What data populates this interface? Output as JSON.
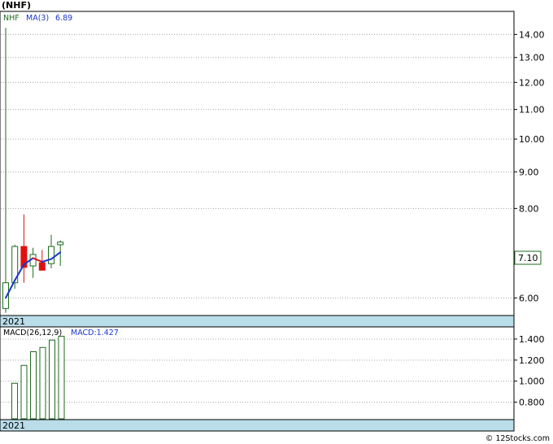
{
  "chart_data": [
    {
      "type": "candlestick",
      "ticker_title": "(NHF)",
      "legend": {
        "symbol": "NHF",
        "ma_label": "MA(3)",
        "ma_value": "6.89"
      },
      "price_axis": {
        "scale": "log",
        "ticks": [
          "14.00",
          "13.00",
          "12.00",
          "11.00",
          "10.00",
          "9.00",
          "8.00",
          "6.00"
        ],
        "tick_values": [
          14,
          13,
          12,
          11,
          10,
          9,
          8,
          6
        ],
        "ylim": [
          5.7,
          15.0
        ],
        "last_price_label": "7.10",
        "last_price": 7.1
      },
      "x_period_label": "2021",
      "candles": [
        {
          "open": 5.8,
          "high": 14.3,
          "low": 5.72,
          "close": 6.3
        },
        {
          "open": 6.3,
          "high": 7.12,
          "low": 6.18,
          "close": 7.08
        },
        {
          "open": 7.08,
          "high": 7.85,
          "low": 6.3,
          "close": 6.62
        },
        {
          "open": 6.65,
          "high": 7.05,
          "low": 6.4,
          "close": 6.9
        },
        {
          "open": 6.72,
          "high": 7.0,
          "low": 6.55,
          "close": 6.56
        },
        {
          "open": 6.7,
          "high": 7.35,
          "low": 6.6,
          "close": 7.08
        },
        {
          "open": 7.12,
          "high": 7.22,
          "low": 6.65,
          "close": 7.18
        }
      ],
      "ma3": [
        6.0,
        6.35,
        6.68,
        6.82,
        6.74,
        6.8,
        6.95
      ]
    },
    {
      "type": "bar",
      "legend": {
        "label": "MACD(26,12,9)",
        "value_label": "MACD:1.427"
      },
      "y_axis": {
        "ticks": [
          "1.400",
          "1.200",
          "1.000",
          "0.800"
        ],
        "tick_values": [
          1.4,
          1.2,
          1.0,
          0.8
        ],
        "ylim": [
          0.65,
          1.5
        ]
      },
      "x_period_label": "2021",
      "values": [
        0.98,
        1.15,
        1.28,
        1.32,
        1.39,
        1.427
      ]
    }
  ],
  "footer": "© 12Stocks.com",
  "colors": {
    "up": "#1f6b1f",
    "down": "#e01010",
    "ma_up": "#1a36d0",
    "ma_down": "#e01010",
    "band": "#b9dde9",
    "grid": "#a8a8a8"
  }
}
